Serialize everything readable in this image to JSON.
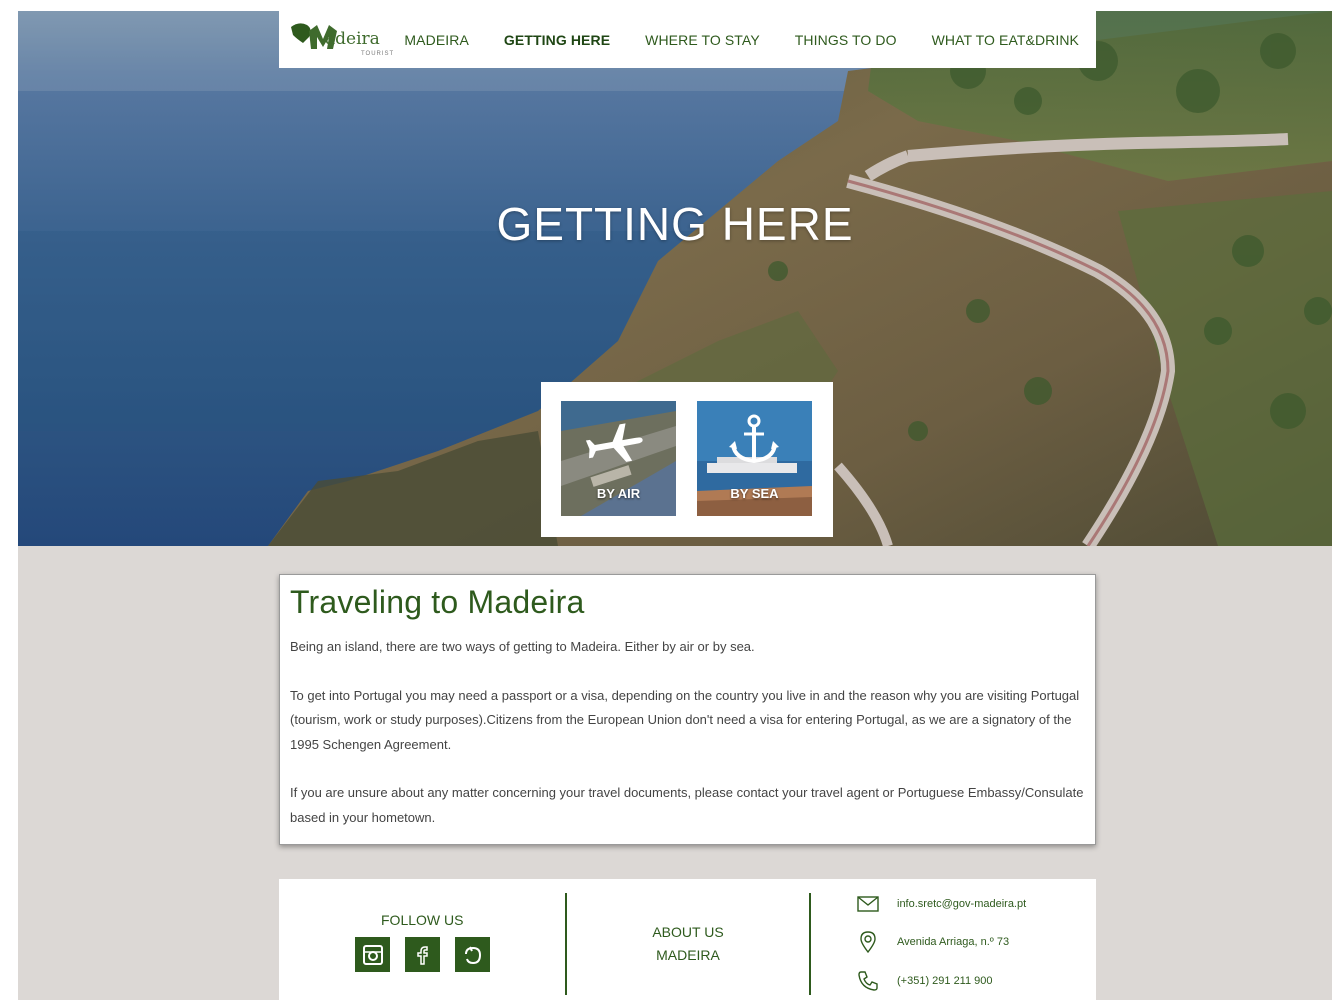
{
  "nav": {
    "logo_word": "adeira",
    "logo_sub": "TOURIST",
    "items": [
      {
        "label": "MADEIRA",
        "active": false
      },
      {
        "label": "GETTING HERE",
        "active": true
      },
      {
        "label": "WHERE TO STAY",
        "active": false
      },
      {
        "label": "THINGS TO DO",
        "active": false
      },
      {
        "label": "WHAT TO EAT&DRINK",
        "active": false
      }
    ]
  },
  "hero": {
    "title": "GETTING HERE",
    "modes": [
      {
        "label": "BY AIR",
        "icon": "airplane-icon"
      },
      {
        "label": "BY SEA",
        "icon": "anchor-icon"
      }
    ]
  },
  "content": {
    "title": "Traveling to Madeira",
    "paragraphs": [
      "Being an island, there are two ways of getting to Madeira. Either by air or by sea.",
      "To get into Portugal you may need a passport or a visa, depending on the country you live in and the reason why you are visiting Portugal (tourism, work or study purposes).Citizens from the European Union don't need a visa for entering Portugal, as we are a signatory of the 1995 Schengen Agreement.",
      "If you are unsure about any matter concerning your travel documents, please contact your travel agent or Portuguese Embassy/Consulate based in your hometown."
    ]
  },
  "footer": {
    "follow_label": "FOLLOW US",
    "social_icons": [
      "instagram-icon",
      "facebook-icon",
      "tripadvisor-icon"
    ],
    "about_line1": "ABOUT US",
    "about_line2": "MADEIRA",
    "email": "info.sretc@gov-madeira.pt",
    "address": "Avenida Arriaga, n.º 73",
    "phone": "(+351) 291 211 900"
  },
  "colors": {
    "brand_green": "#2e5a1d",
    "page_bg": "#dcd8d5"
  }
}
